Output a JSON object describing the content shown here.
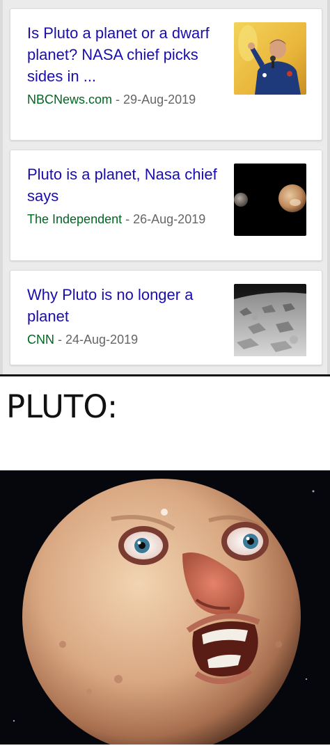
{
  "news_results": [
    {
      "title": "Is Pluto a planet or a dwarf planet? NASA chief picks sides in ...",
      "source": "NBCNews.com",
      "date": "29-Aug-2019",
      "thumbnail": "man-speaking-at-microphone"
    },
    {
      "title": "Pluto is a planet, Nasa chief says",
      "source": "The Independent",
      "date": "26-Aug-2019",
      "thumbnail": "pluto-and-charon"
    },
    {
      "title": "Why Pluto is no longer a planet",
      "source": "CNN",
      "date": "24-Aug-2019",
      "thumbnail": "pluto-surface"
    }
  ],
  "meme": {
    "caption": "PLUTO:",
    "image": "angry-moon-face"
  },
  "colors": {
    "title_link": "#1a0dab",
    "source": "#006621",
    "meta": "#666666",
    "background": "#ebebeb"
  }
}
